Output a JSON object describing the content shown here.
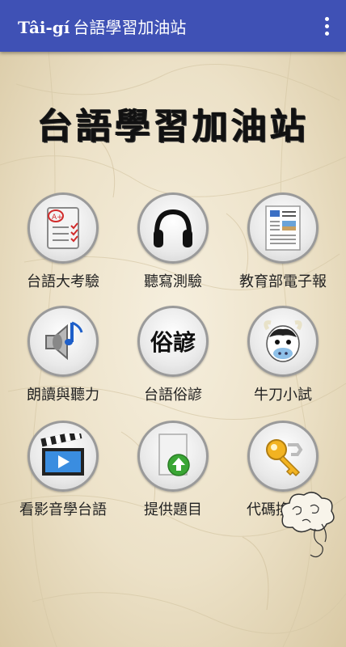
{
  "appbar": {
    "latin_title": "Tâi-gí",
    "title": "台語學習加油站",
    "menu_icon": "more-vert-icon"
  },
  "main": {
    "banner_title": "台語學習加油站"
  },
  "menu": [
    {
      "label": "台語大考驗",
      "icon": "exam-paper-icon"
    },
    {
      "label": "聽寫測驗",
      "icon": "headphones-icon"
    },
    {
      "label": "教育部電子報",
      "icon": "newspaper-icon"
    },
    {
      "label": "朗讀與聽力",
      "icon": "speaker-music-icon"
    },
    {
      "label": "台語俗諺",
      "icon": "proverb-text-icon",
      "icon_text": "俗諺"
    },
    {
      "label": "牛刀小試",
      "icon": "cow-icon"
    },
    {
      "label": "看影音學台語",
      "icon": "clapperboard-icon"
    },
    {
      "label": "提供題目",
      "icon": "upload-document-icon"
    },
    {
      "label": "代碼換金幣",
      "icon": "key-icon"
    }
  ],
  "colors": {
    "appbar": "#3f51b5",
    "paper": "#efe6d2"
  }
}
